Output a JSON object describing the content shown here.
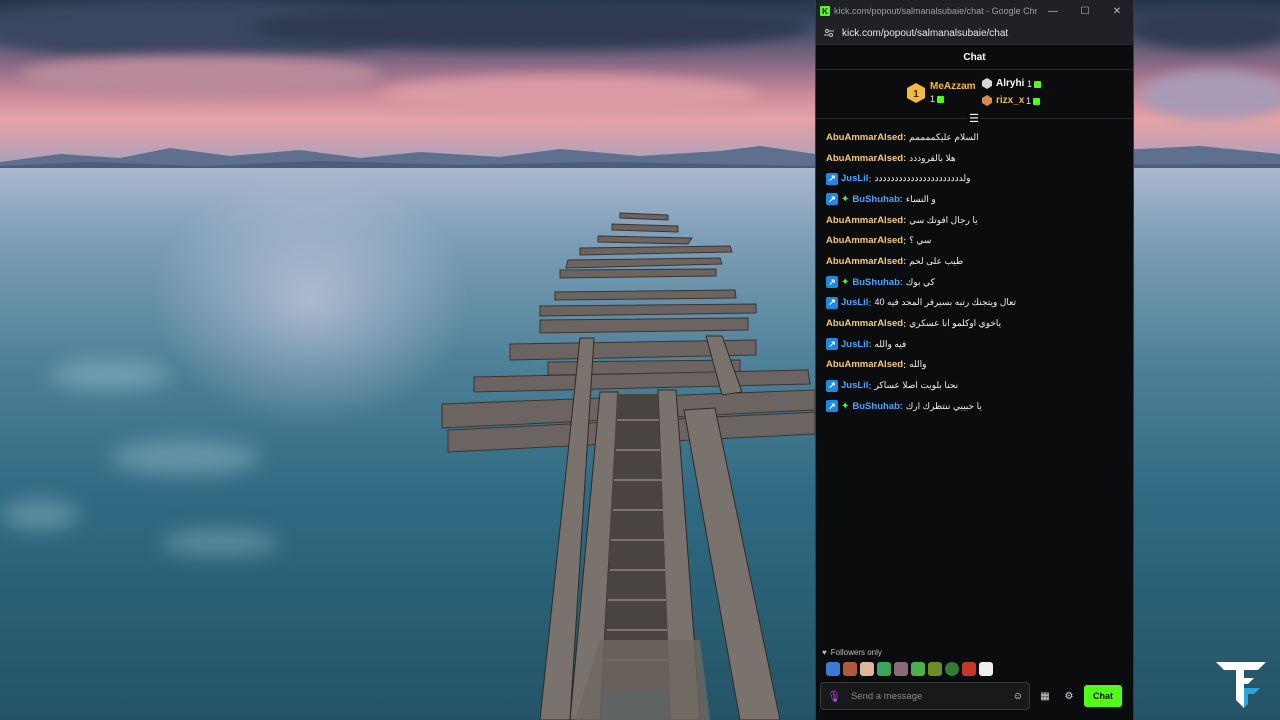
{
  "browser": {
    "title": "kick.com/popout/salmanalsubaie/chat - Google Chrome",
    "url": "kick.com/popout/salmanalsubaie/chat",
    "minimize_icon": "minimize-icon",
    "maximize_icon": "maximize-icon",
    "close_icon": "close-icon"
  },
  "chat": {
    "header": "Chat",
    "leaderboard": [
      {
        "rank": "1",
        "name": "MeAzzam",
        "count": "1",
        "color": "#f5b93d"
      },
      {
        "rank": "2",
        "name": "Alryhi",
        "count": "1",
        "color": "#ffffff"
      },
      {
        "rank": "3",
        "name": "rizx_x",
        "count": "1",
        "color": "#f5b93d"
      }
    ],
    "messages": [
      {
        "user": "AbuAmmarAlsed",
        "color": "#f5c97a",
        "badges": [],
        "text": "السلام عليكممممم"
      },
      {
        "user": "AbuAmmarAlsed",
        "color": "#f5c97a",
        "badges": [],
        "text": "هلا بالقروددد"
      },
      {
        "user": "JusLil",
        "color": "#4da3ff",
        "badges": [
          "mod"
        ],
        "text": "ولدددددددددددددددددددددد"
      },
      {
        "user": "BuShuhab",
        "color": "#4da3ff",
        "badges": [
          "mod",
          "star"
        ],
        "text": "و النساء"
      },
      {
        "user": "AbuAmmarAlsed",
        "color": "#f5c97a",
        "badges": [],
        "text": "يا رجال افوتك سي"
      },
      {
        "user": "AbuAmmarAlsed",
        "color": "#f5c97a",
        "badges": [],
        "text": "سي ؟"
      },
      {
        "user": "AbuAmmarAlsed",
        "color": "#f5c97a",
        "badges": [],
        "text": "طيب على لحم"
      },
      {
        "user": "BuShuhab",
        "color": "#4da3ff",
        "badges": [
          "mod",
          "star"
        ],
        "text": "كي بوك"
      },
      {
        "user": "JusLil",
        "color": "#4da3ff",
        "badges": [
          "mod"
        ],
        "text": "تعال ويتجنك رتبه بسيرفر المحد فيه 40"
      },
      {
        "user": "AbuAmmarAlsed",
        "color": "#f5c97a",
        "badges": [],
        "text": "ياخوي اوكلمو انا عسكري"
      },
      {
        "user": "JusLil",
        "color": "#4da3ff",
        "badges": [
          "mod"
        ],
        "text": "فيه والله"
      },
      {
        "user": "AbuAmmarAlsed",
        "color": "#f5c97a",
        "badges": [],
        "text": "والله"
      },
      {
        "user": "JusLil",
        "color": "#4da3ff",
        "badges": [
          "mod"
        ],
        "text": "نحنا بلويت اصلا عساكر"
      },
      {
        "user": "BuShuhab",
        "color": "#4da3ff",
        "badges": [
          "mod",
          "star"
        ],
        "text": "يا حبيبي ننتظرك ارك"
      }
    ],
    "followers_only": "Followers only",
    "input_placeholder": "Send a message",
    "send_label": "Chat",
    "accent": "#53fc18"
  }
}
